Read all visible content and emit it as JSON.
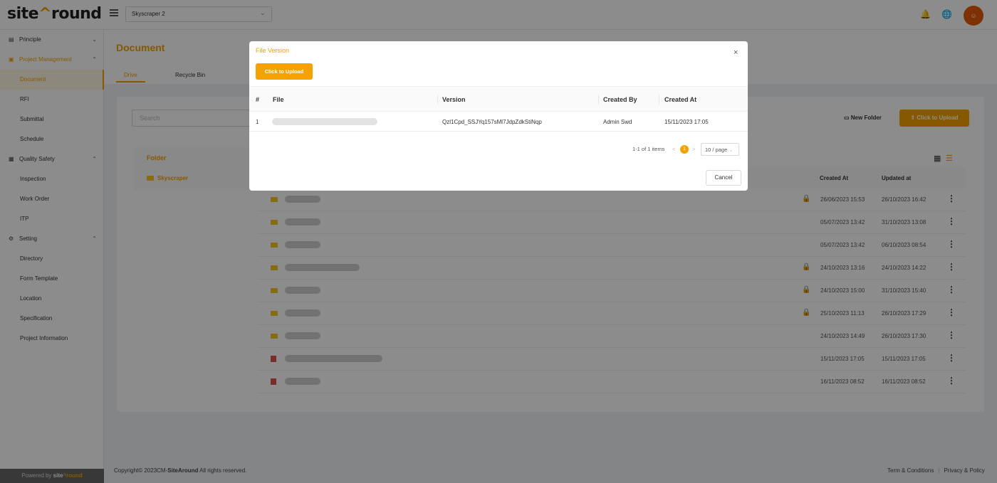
{
  "header": {
    "logo_left": "site",
    "logo_right": "round",
    "project": "Skyscraper 2",
    "icons": [
      "bell-icon",
      "globe-icon",
      "avatar"
    ]
  },
  "sidebar": {
    "groups": [
      {
        "label": "Principle",
        "icon": "id-card-icon",
        "chevron": "v"
      },
      {
        "label": "Project Management",
        "icon": "projector-icon",
        "chevron": "^"
      },
      {
        "label": "Quality Safety",
        "icon": "building-icon",
        "chevron": "^"
      },
      {
        "label": "Setting",
        "icon": "gears-icon",
        "chevron": "^"
      }
    ],
    "items": [
      "Document",
      "RFI",
      "Submittal",
      "Schedule",
      "Inspection",
      "Work Order",
      "ITP",
      "Directory",
      "Form Template",
      "Location",
      "Specification",
      "Project Information"
    ],
    "powered_prefix": "Powered by",
    "powered_left": "site",
    "powered_right": "round"
  },
  "page": {
    "title": "Document",
    "tabs": [
      "Drive",
      "Recycle Bin"
    ],
    "search_placeholder": "Search",
    "new_folder": "New Folder",
    "upload": "Click to Upload"
  },
  "folders": {
    "heading": "Folder",
    "item": "Skyscraper"
  },
  "list": {
    "created_header": "Created At",
    "updated_header": "Updated at",
    "rows": [
      {
        "type": "folder",
        "locked": true,
        "created": "26/06/2023 15:53",
        "updated": "26/10/2023 16:42"
      },
      {
        "type": "folder",
        "locked": false,
        "created": "05/07/2023 13:42",
        "updated": "31/10/2023 13:08"
      },
      {
        "type": "folder",
        "locked": false,
        "created": "05/07/2023 13:42",
        "updated": "06/10/2023 08:54"
      },
      {
        "type": "folder",
        "locked": true,
        "created": "24/10/2023 13:16",
        "updated": "24/10/2023 14:22"
      },
      {
        "type": "folder",
        "locked": true,
        "created": "24/10/2023 15:00",
        "updated": "31/10/2023 15:40"
      },
      {
        "type": "folder",
        "locked": true,
        "created": "25/10/2023 11:13",
        "updated": "26/10/2023 17:29"
      },
      {
        "type": "folder",
        "locked": false,
        "created": "24/10/2023 14:49",
        "updated": "26/10/2023 17:30"
      },
      {
        "type": "pdf",
        "locked": false,
        "created": "15/11/2023 17:05",
        "updated": "15/11/2023 17:05"
      },
      {
        "type": "pdf",
        "locked": false,
        "created": "16/11/2023 08:52",
        "updated": "16/11/2023 08:52"
      }
    ]
  },
  "footer": {
    "copyright_prefix": "Copyright© 2023CM-",
    "copyright_brand": "SiteAround",
    "copyright_suffix": " All rights reserved.",
    "terms": "Term & Conditions",
    "separator": "|",
    "privacy": "Privacy & Policy"
  },
  "modal": {
    "title": "File Version",
    "close": "×",
    "upload": "Click to Upload",
    "columns": [
      "#",
      "File",
      "Version",
      "Created By",
      "Created At"
    ],
    "rows": [
      {
        "num": "1",
        "version": "Qzl1Cpd_SSJYq157sMl7JdpZdkStiNqp",
        "created_by": "Admin Swd",
        "created_at": "15/11/2023 17:05"
      }
    ],
    "pagination": {
      "summary": "1-1 of 1 items",
      "prev": "<",
      "current": "1",
      "next": ">",
      "page_size": "10 / page"
    },
    "cancel": "Cancel"
  },
  "colors": {
    "accent": "#f5a100",
    "avatar": "#e8590c"
  }
}
